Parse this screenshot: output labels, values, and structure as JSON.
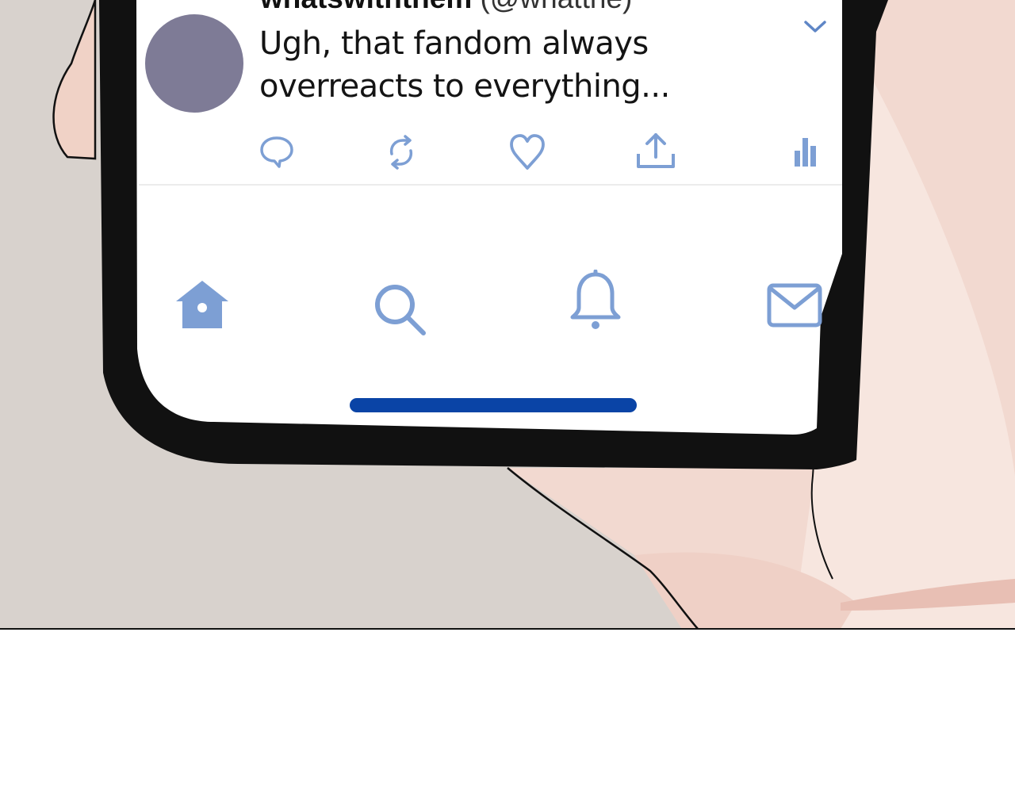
{
  "tweet": {
    "username": "whatswiththem",
    "handle": "(@whatthe)",
    "text": "Ugh, that fandom always overreacts to everything..."
  },
  "icons": {
    "more": "chevron-down-icon",
    "reply": "speech-bubble-icon",
    "retweet": "retweet-icon",
    "like": "heart-icon",
    "share": "share-upload-icon",
    "stats": "bar-chart-icon",
    "home": "home-icon",
    "search": "search-icon",
    "notifications": "bell-icon",
    "messages": "envelope-icon"
  },
  "colors": {
    "icon": "#7d9fd4",
    "home_indicator": "#0a44a6",
    "avatar": "#7e7b96",
    "phone_frame": "#0f0f0f",
    "skin": "#f0d2c8"
  }
}
